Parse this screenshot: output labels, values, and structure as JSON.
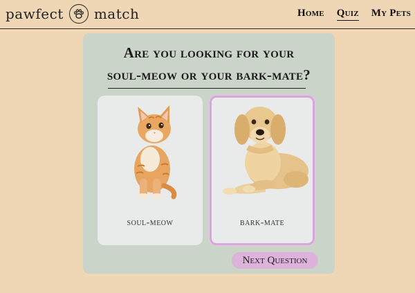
{
  "header": {
    "logo_left": "pawfect",
    "logo_icon": "paw-icon",
    "logo_right": "match",
    "nav": [
      {
        "label": "Home",
        "active": false
      },
      {
        "label": "Quiz",
        "active": true
      },
      {
        "label": "My Pets",
        "active": false
      }
    ]
  },
  "quiz": {
    "question": "Are you looking for your soul-meow or your bark-mate?",
    "options": [
      {
        "label": "soul-meow",
        "image": "kitten-photo"
      },
      {
        "label": "bark-mate",
        "image": "golden-retriever-photo",
        "selected": true
      }
    ],
    "next_label": "Next Question"
  },
  "colors": {
    "page_bg": "#efd6b5",
    "card_bg": "#cbd4c9",
    "option_bg": "#e8ebe9",
    "accent": "#ddb3dc"
  }
}
